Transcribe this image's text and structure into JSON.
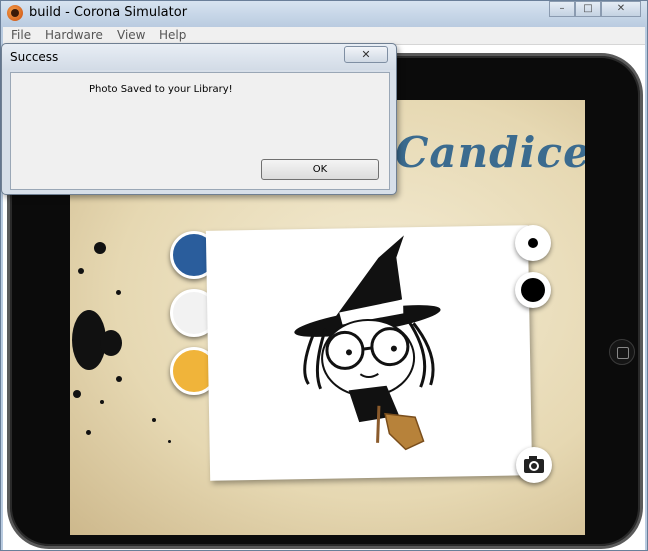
{
  "window": {
    "title": "build - Corona Simulator",
    "controls": {
      "minimize": "–",
      "maximize": "□",
      "close": "✕"
    }
  },
  "menu": {
    "items": [
      "File",
      "Hardware",
      "View",
      "Help"
    ]
  },
  "app": {
    "title": "Candice",
    "palette": [
      {
        "name": "blue",
        "color": "#2a5d9c"
      },
      {
        "name": "white",
        "color": "#f2f2f2"
      },
      {
        "name": "yellow",
        "color": "#f0b43a"
      }
    ],
    "brush_sizes": [
      "small",
      "large"
    ],
    "camera_icon": "camera-icon"
  },
  "dialog": {
    "title": "Success",
    "close_label": "✕",
    "message": "Photo Saved to your Library!",
    "ok_label": "OK"
  },
  "colors": {
    "accent_title": "#3b6b8f",
    "device_bezel": "#0b0b0b"
  }
}
